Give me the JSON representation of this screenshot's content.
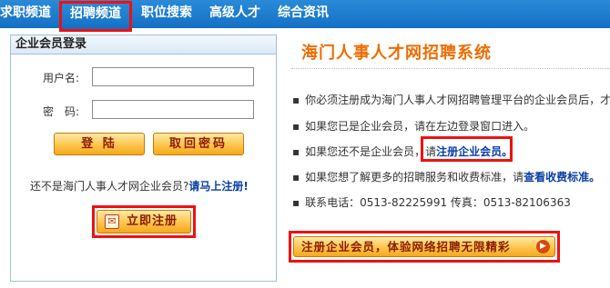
{
  "nav": {
    "items": [
      {
        "label": "求职频道"
      },
      {
        "label": "招聘频道"
      },
      {
        "label": "职位搜索"
      },
      {
        "label": "高级人才"
      },
      {
        "label": "综合资讯"
      }
    ]
  },
  "login": {
    "header": "企业会员登录",
    "username_label": "用户名:",
    "password_label": "密　码:",
    "username_value": "",
    "password_value": "",
    "login_button": "登 陆",
    "retrieve_password_button": "取回密码",
    "not_member_prefix": "还不是海门人事人才网企业会员?",
    "register_link": "请马上注册!",
    "register_now_button": "立即注册",
    "register_icon": "register-icon"
  },
  "main": {
    "title": "海门人事人才网招聘系统",
    "lines": [
      {
        "text": "你必须注册成为海门人事人才网招聘管理平台的企业会员后，才"
      },
      {
        "text": "如果您已是企业会员，请在左边登录窗口进入。"
      },
      {
        "text": "如果您还不是企业会员，请",
        "link": "注册企业会员。"
      },
      {
        "text": "如果您想了解更多的招聘服务和收费标准，请",
        "link": "查看收费标准。"
      },
      {
        "text": "联系电话：0513-82225991 传真：0513-82106363"
      }
    ],
    "big_register_button": "注册企业会员，体验网络招聘无限精彩",
    "arrow_icon": "arrow-right-icon"
  },
  "colors": {
    "nav_bg": "#1a7ccc",
    "highlight_red": "#ee1111",
    "title_orange": "#ef6c00",
    "link_blue": "#0a3fa8",
    "button_orange": "#ffc44d"
  }
}
